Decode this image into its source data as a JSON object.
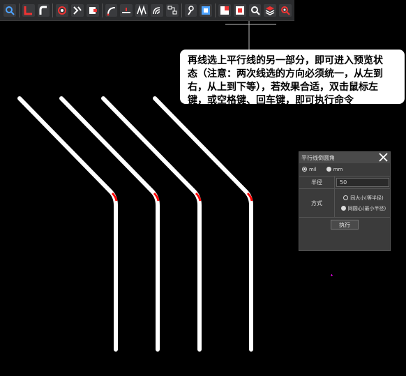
{
  "toolbar": {
    "icons": [
      "select-icon",
      "route-icon",
      "corner-icon",
      "loop-icon",
      "unroute-icon",
      "via-icon",
      "arc-icon",
      "length-icon",
      "diff-pair-icon",
      "serpentine-icon",
      "gloss-icon",
      "pin-swap-icon",
      "fanout-icon",
      "fit-view-icon",
      "copper-icon",
      "shape-icon",
      "zoom-icon",
      "layers-icon",
      "zoom-area-icon"
    ]
  },
  "callout": {
    "line1": "再线选上平行线的另一部分，即可进入预览状",
    "line2": "态（注意：两次线选的方向必须统一，从左到",
    "line3": "右，从上到下等），若效果合适，双击鼠标左",
    "line4": "键，或空格键、回车键，即可执行命令"
  },
  "dialog": {
    "title": "平行线倒圆角",
    "unit_mil": "mil",
    "unit_mm": "mm",
    "radius_label": "半径",
    "radius_value": "50",
    "mode_label": "方式",
    "mode_opt1": "同大小(等半径)",
    "mode_opt2": "同圆心(最小半径)",
    "execute_label": "执行"
  },
  "colors": {
    "trace": "#ffffff",
    "highlight": "#ff0000",
    "crosshair": "#cccccc",
    "background": "#000000"
  }
}
